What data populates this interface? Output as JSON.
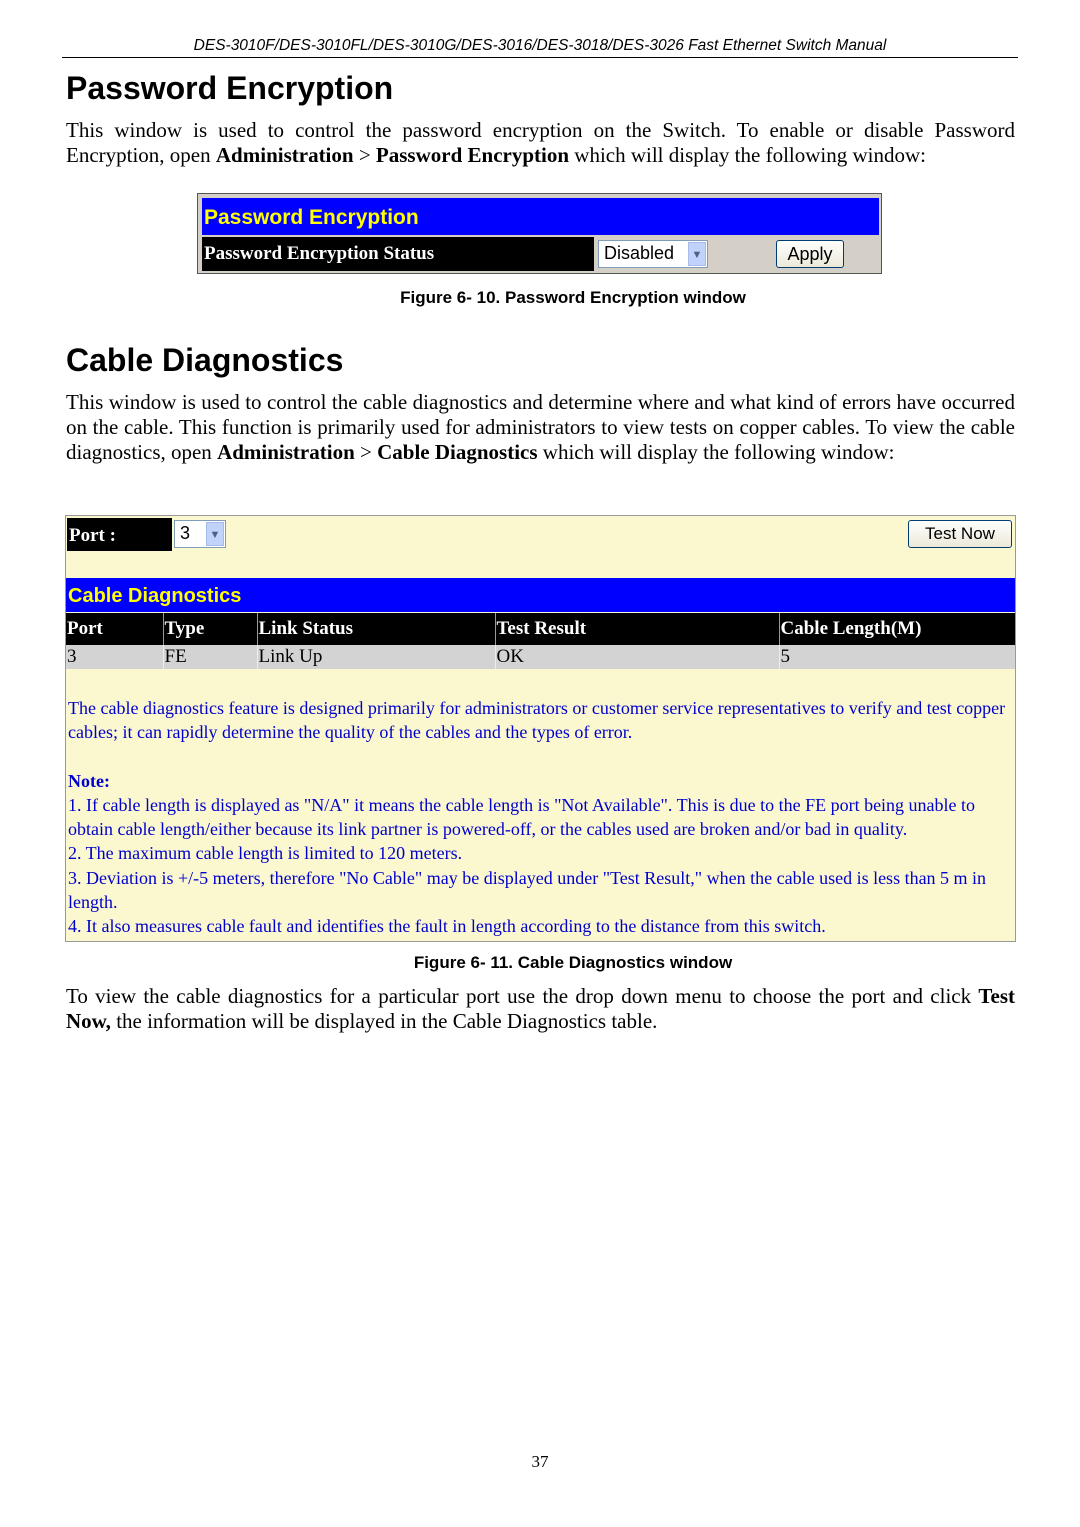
{
  "running_header": "DES-3010F/DES-3010FL/DES-3010G/DES-3016/DES-3018/DES-3026 Fast Ethernet Switch Manual",
  "section1": {
    "title": "Password Encryption",
    "para_a": "This window is used to control the password encryption on the Switch.  To enable or disable Password Encryption, open ",
    "bold_1": "Administration",
    "sep": " > ",
    "bold_2": "Password Encryption",
    "para_b": " which will display the following window:",
    "figure": {
      "title": "Password Encryption",
      "label": "Password Encryption Status",
      "select_value": "Disabled",
      "apply_label": "Apply"
    },
    "caption": "Figure 6- 10. Password Encryption window"
  },
  "section2": {
    "title": "Cable Diagnostics",
    "para_a": "This window is used to control the cable diagnostics and determine where and what kind of errors have occurred on the cable. This function is primarily used for administrators to view tests on copper cables. To view the cable diagnostics, open ",
    "bold_1": "Administration",
    "sep": " > ",
    "bold_2": "Cable Diagnostics",
    "para_b": " which will display the following window:",
    "figure": {
      "port_label": "Port :",
      "port_value": "3",
      "test_now_label": "Test Now",
      "title": "Cable Diagnostics",
      "columns": [
        "Port",
        "Type",
        "Link Status",
        "Test Result",
        "Cable Length(M)"
      ],
      "rows": [
        [
          "3",
          "FE",
          "Link Up",
          "OK",
          "5"
        ]
      ],
      "description": "The cable diagnostics feature is designed primarily for administrators or customer service representatives to verify and test copper cables; it can rapidly determine the quality of the cables and the types of error.",
      "note_title": "Note:",
      "notes": [
        "1. If cable length is displayed as \"N/A\" it means the cable length is \"Not Available\". This is due to the FE port being unable to obtain cable length/either because its link partner is powered-off, or the cables used are broken and/or bad in quality.",
        "2. The maximum cable length is limited to 120 meters.",
        "3. Deviation is +/-5 meters, therefore \"No Cable\" may be displayed under \"Test Result,\" when the cable used is less than 5 m in length.",
        "4. It also measures cable fault and identifies the fault in length according to the distance from this switch."
      ]
    },
    "caption": "Figure 6- 11.  Cable Diagnostics window",
    "para2_a": "To view the cable diagnostics for a particular port use the drop down menu to choose the port and click ",
    "para2_bold": "Test Now,",
    "para2_b": " the information will be displayed in the Cable Diagnostics table."
  },
  "page_number": "37",
  "colors": {
    "title_bar": "#0000ff",
    "title_text": "#ffff00",
    "note_text": "#0000cc",
    "panel_bg": "#fbf8cf"
  }
}
